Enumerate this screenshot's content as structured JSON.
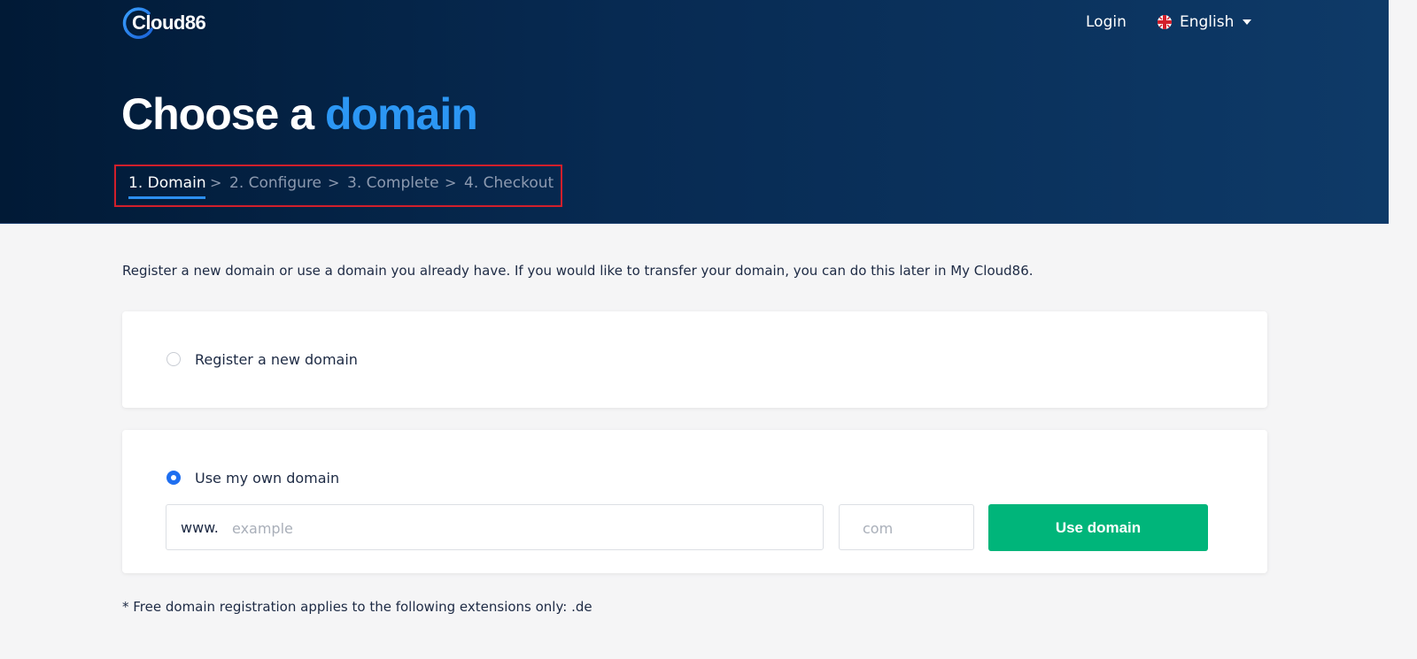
{
  "header": {
    "logo_text": "Cloud86",
    "login_label": "Login",
    "language_label": "English",
    "icons": {
      "language": "uk-flag-icon",
      "dropdown": "caret-down-icon",
      "logo": "cloud86-logo"
    }
  },
  "hero": {
    "title_prefix": "Choose a",
    "title_accent": "domain",
    "colors": {
      "accent": "#2c97f4",
      "background": "#011a36",
      "highlight_box": "#d21f2b"
    }
  },
  "steps": [
    {
      "label": "1. Domain",
      "active": true
    },
    {
      "label": "2. Configure",
      "active": false
    },
    {
      "label": "3. Complete",
      "active": false
    },
    {
      "label": "4. Checkout",
      "active": false
    }
  ],
  "step_separator": ">",
  "main": {
    "intro_text": "Register a new domain or use a domain you already have. If you would like to transfer your domain, you can do this later in My Cloud86.",
    "option_register": {
      "label": "Register a new domain",
      "selected": false
    },
    "option_own": {
      "label": "Use my own domain",
      "selected": true,
      "prefix": "www.",
      "domain_placeholder": "example",
      "extension_placeholder": "com",
      "button_label": "Use domain",
      "button_color": "#00b57a"
    },
    "footnote": "* Free domain registration applies to the following extensions only: .de"
  }
}
